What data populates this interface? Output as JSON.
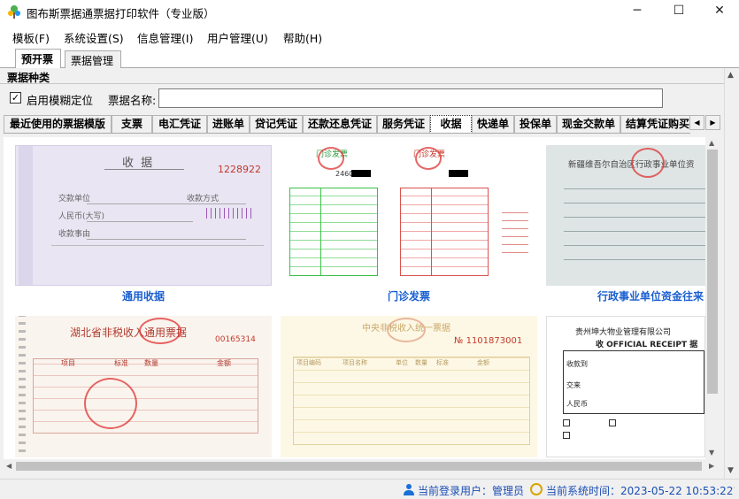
{
  "window": {
    "title": "图布斯票据通票据打印软件（专业版）",
    "minimize": "─",
    "maximize": "☐",
    "close": "✕"
  },
  "menu": [
    {
      "label": "模板(F)"
    },
    {
      "label": "系统设置(S)"
    },
    {
      "label": "信息管理(I)"
    },
    {
      "label": "用户管理(U)"
    },
    {
      "label": "帮助(H)"
    }
  ],
  "tabs": [
    {
      "label": "预开票"
    },
    {
      "label": "票据管理"
    }
  ],
  "section": {
    "title": "票据种类"
  },
  "fuzzy": {
    "label": "启用模糊定位",
    "checked": true,
    "check_glyph": "✓"
  },
  "search": {
    "label": "票据名称:",
    "value": ""
  },
  "categories": [
    {
      "label": "最近使用的票据模版"
    },
    {
      "label": "支票"
    },
    {
      "label": "电汇凭证"
    },
    {
      "label": "进账单"
    },
    {
      "label": "贷记凭证"
    },
    {
      "label": "还款还息凭证"
    },
    {
      "label": "服务凭证"
    },
    {
      "label": "收据"
    },
    {
      "label": "快递单"
    },
    {
      "label": "投保单"
    },
    {
      "label": "现金交款单"
    },
    {
      "label": "结算凭证购买"
    }
  ],
  "active_category": "收据",
  "templates": [
    {
      "caption": "通用收据",
      "img_title": "收    据",
      "img_number": "1228922",
      "img_rows": [
        "交款单位",
        "人民币(大写)",
        "收款事由"
      ],
      "img_extra": "收款方式"
    },
    {
      "caption": "门诊发票",
      "img_title": "门诊发票",
      "img_number": "246025"
    },
    {
      "caption": "行政事业单位资金往来",
      "img_title": "新疆维吾尔自治区行政事业单位资"
    },
    {
      "caption": "",
      "img_title": "湖北省非税收入通用票据",
      "img_number": "00165314",
      "img_rows": [
        "项目",
        "标准",
        "数量",
        "金额"
      ]
    },
    {
      "caption": "",
      "img_title": "中央非税收入统一票据",
      "img_number": "№ 1101873001",
      "img_rows": [
        "项目编码",
        "项目名称",
        "单位",
        "数量",
        "标准",
        "金额"
      ]
    },
    {
      "caption": "",
      "img_title": "贵州坤大物业管理有限公司",
      "img_subtitle": "收 OFFICIAL RECEIPT 据",
      "img_rows": [
        "收款到",
        "交来",
        "人民币"
      ]
    }
  ],
  "status": {
    "user_label": "当前登录用户：管理员",
    "time_label": "当前系统时间：2023-05-22 10:53:22"
  },
  "colors": {
    "caption": "#1a5fd0",
    "status": "#1a4db5",
    "stamp": "#d33333"
  }
}
